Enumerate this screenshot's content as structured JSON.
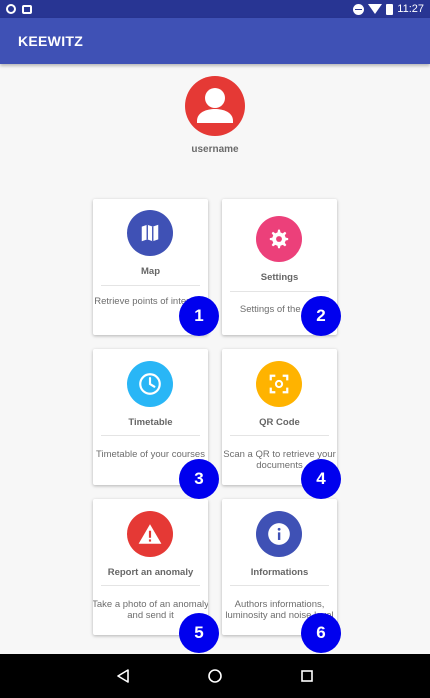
{
  "status_bar": {
    "time": "11:27"
  },
  "app_bar": {
    "title": "KEEWITZ"
  },
  "profile": {
    "username": "username"
  },
  "cards": [
    {
      "title": "Map",
      "description": "Retrieve points of interests",
      "color": "#3f51b5",
      "icon": "map-icon",
      "badge": "1"
    },
    {
      "title": "Settings",
      "description": "Settings of the app",
      "color": "#ec407a",
      "icon": "gear-icon",
      "badge": "2"
    },
    {
      "title": "Timetable",
      "description": "Timetable of your courses",
      "color": "#29b6f6",
      "icon": "clock-icon",
      "badge": "3"
    },
    {
      "title": "QR Code",
      "description": "Scan a QR to retrieve your documents",
      "color": "#ffb300",
      "icon": "qr-scan-icon",
      "badge": "4"
    },
    {
      "title": "Report an anomaly",
      "description": "Take a photo of an anomaly and send it",
      "color": "#e53935",
      "icon": "warning-icon",
      "badge": "5"
    },
    {
      "title": "Informations",
      "description": "Authors informations, luminosity and noise level",
      "color": "#3f51b5",
      "icon": "info-icon",
      "badge": "6"
    }
  ]
}
